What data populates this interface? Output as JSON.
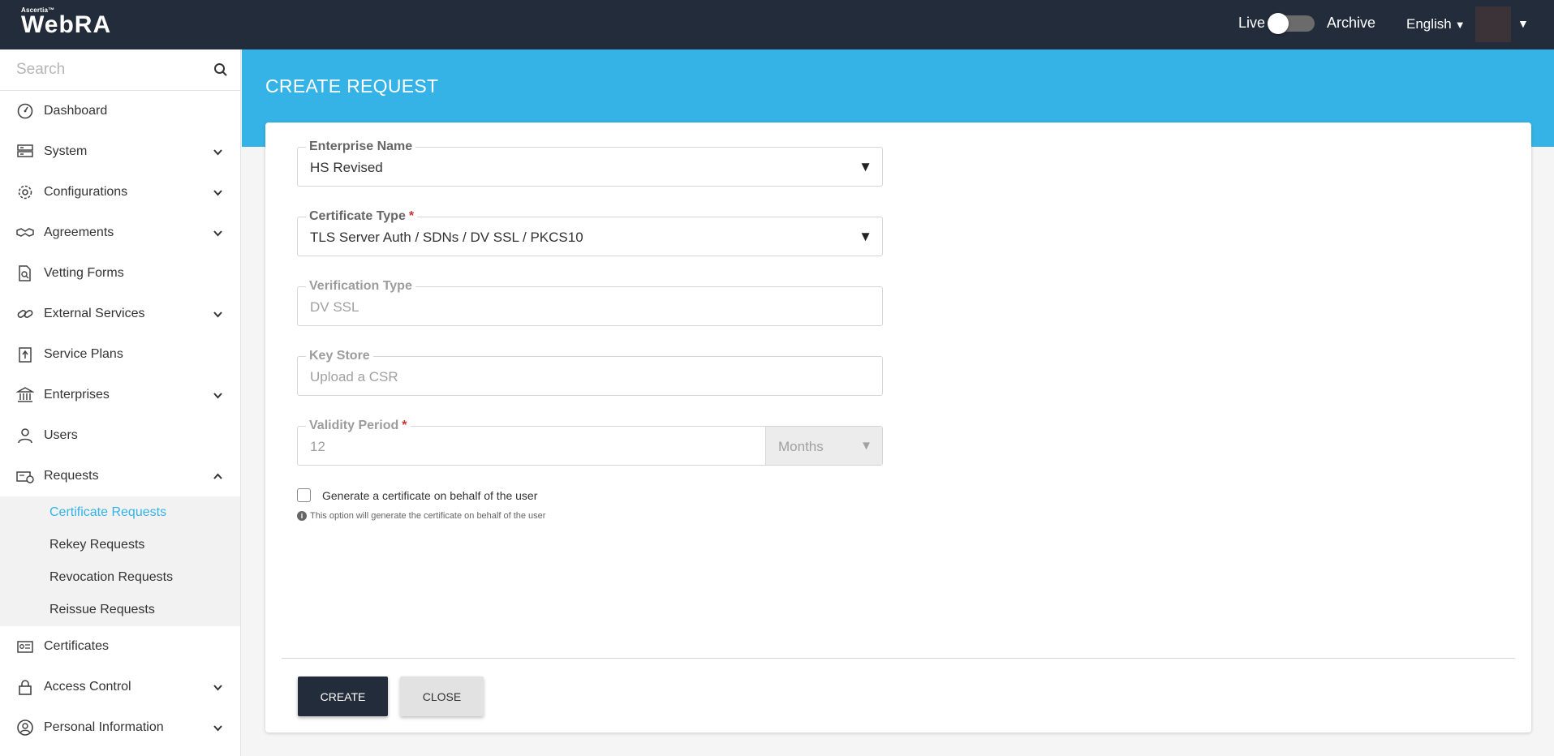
{
  "header": {
    "logo_small": "Ascertia™",
    "logo_main": "WebRA",
    "live_label": "Live",
    "archive_label": "Archive",
    "language": "English",
    "toggle_state": "live"
  },
  "sidebar": {
    "search_placeholder": "Search",
    "items": [
      {
        "label": "Dashboard",
        "icon": "dashboard-icon",
        "expandable": false
      },
      {
        "label": "System",
        "icon": "server-icon",
        "expandable": true
      },
      {
        "label": "Configurations",
        "icon": "gear-icon",
        "expandable": true
      },
      {
        "label": "Agreements",
        "icon": "handshake-icon",
        "expandable": true
      },
      {
        "label": "Vetting Forms",
        "icon": "document-search-icon",
        "expandable": false
      },
      {
        "label": "External Services",
        "icon": "link-icon",
        "expandable": true
      },
      {
        "label": "Service Plans",
        "icon": "clipboard-upload-icon",
        "expandable": false
      },
      {
        "label": "Enterprises",
        "icon": "bank-icon",
        "expandable": true
      },
      {
        "label": "Users",
        "icon": "user-icon",
        "expandable": false
      },
      {
        "label": "Requests",
        "icon": "requests-icon",
        "expandable": true,
        "expanded": true
      },
      {
        "label": "Certificates",
        "icon": "certificate-icon",
        "expandable": false
      },
      {
        "label": "Access Control",
        "icon": "lock-icon",
        "expandable": true
      },
      {
        "label": "Personal Information",
        "icon": "user-circle-icon",
        "expandable": true
      }
    ],
    "requests_subitems": [
      {
        "label": "Certificate Requests",
        "active": true
      },
      {
        "label": "Rekey Requests",
        "active": false
      },
      {
        "label": "Revocation Requests",
        "active": false
      },
      {
        "label": "Reissue Requests",
        "active": false
      }
    ]
  },
  "page": {
    "title": "CREATE REQUEST"
  },
  "form": {
    "enterprise_name": {
      "label": "Enterprise Name",
      "value": "HS Revised"
    },
    "certificate_type": {
      "label": "Certificate Type",
      "required_mark": "*",
      "value": "TLS Server Auth / SDNs / DV SSL / PKCS10"
    },
    "verification_type": {
      "label": "Verification Type",
      "value": "DV SSL"
    },
    "key_store": {
      "label": "Key Store",
      "value": "Upload a CSR"
    },
    "validity_period": {
      "label": "Validity Period",
      "required_mark": "*",
      "value": "12",
      "unit": "Months"
    },
    "on_behalf_checkbox": {
      "label": "Generate a certificate on behalf of the user",
      "checked": false
    },
    "hint": "This option will generate the certificate on behalf of the user",
    "create_button": "CREATE",
    "close_button": "CLOSE"
  },
  "colors": {
    "topbar": "#232c3b",
    "accent": "#35b3e6",
    "required": "#cc3333"
  }
}
